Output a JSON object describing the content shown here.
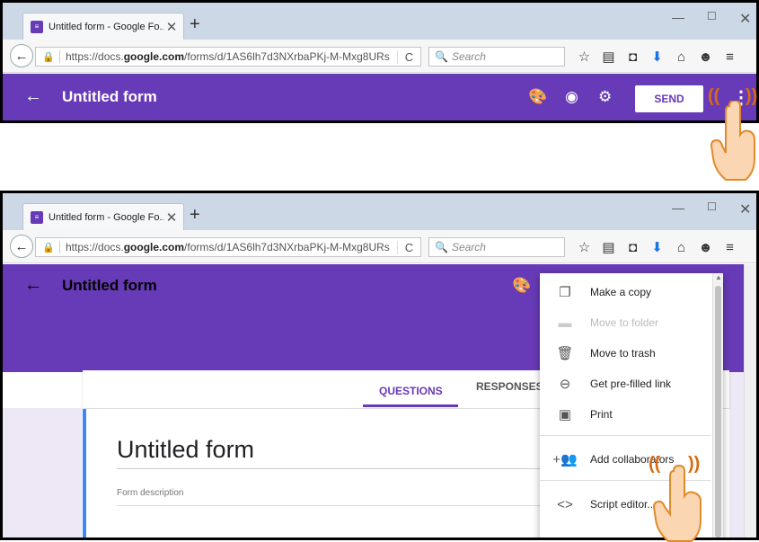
{
  "browser": {
    "tab_title": "Untitled form - Google Fo...",
    "tab_close": "✕",
    "new_tab": "+",
    "win_min": "—",
    "win_max": "☐",
    "win_close": "✕",
    "url_prefix": "https://docs.",
    "url_domain": "google.com",
    "url_suffix": "/forms/d/1AS6lh7d3NXrbaPKj-M-Mxg8URs",
    "reload_icon": "C",
    "search_placeholder": "Search",
    "toolbar_icons": [
      "star-icon",
      "reading-list-icon",
      "pocket-icon",
      "download-icon",
      "home-icon",
      "chat-icon",
      "menu-icon"
    ]
  },
  "formbar": {
    "title": "Untitled form",
    "send_label": "SEND",
    "icons": [
      "palette-icon",
      "preview-eye-icon",
      "settings-gear-icon",
      "more-vert-icon"
    ],
    "color": "#673ab7"
  },
  "form": {
    "tabs": [
      "QUESTIONS",
      "RESPONSES"
    ],
    "active_tab": "QUESTIONS",
    "title": "Untitled form",
    "description_placeholder": "Form description"
  },
  "menu": {
    "items": [
      {
        "label": "Make a copy",
        "icon": "copy-icon",
        "enabled": true
      },
      {
        "label": "Move to folder",
        "icon": "folder-icon",
        "enabled": false
      },
      {
        "label": "Move to trash",
        "icon": "trash-icon",
        "enabled": true
      },
      {
        "label": "Get pre-filled link",
        "icon": "link-icon",
        "enabled": true
      },
      {
        "label": "Print",
        "icon": "print-icon",
        "enabled": true
      },
      {
        "label": "Add collaborators",
        "icon": "add-people-icon",
        "enabled": true
      },
      {
        "label": "Script editor...",
        "icon": "code-icon",
        "enabled": true
      }
    ]
  }
}
